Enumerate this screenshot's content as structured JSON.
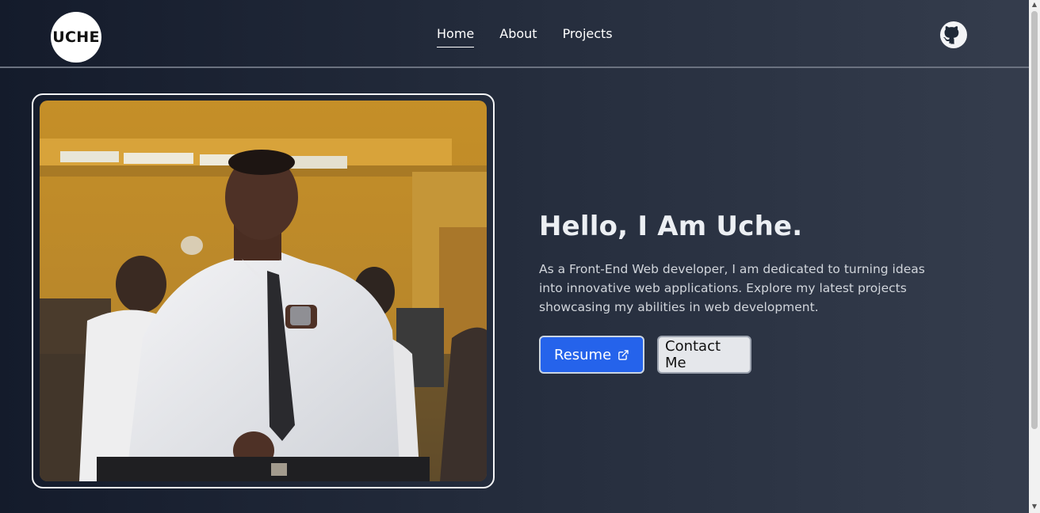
{
  "header": {
    "logo_text": "UCHE",
    "nav": [
      {
        "label": "Home",
        "active": true
      },
      {
        "label": "About",
        "active": false
      },
      {
        "label": "Projects",
        "active": false
      }
    ],
    "github_icon": "github-icon"
  },
  "hero": {
    "title": "Hello, I Am Uche.",
    "description": "As a Front-End Web developer, I am dedicated to turning ideas into innovative web applications. Explore my latest projects showcasing my abilities in web development.",
    "resume_label": "Resume",
    "resume_icon": "external-link-icon",
    "contact_label": "Contact Me"
  },
  "colors": {
    "primary_button": "#2563eb",
    "background_start": "#141b2b",
    "background_end": "#353d4d"
  }
}
